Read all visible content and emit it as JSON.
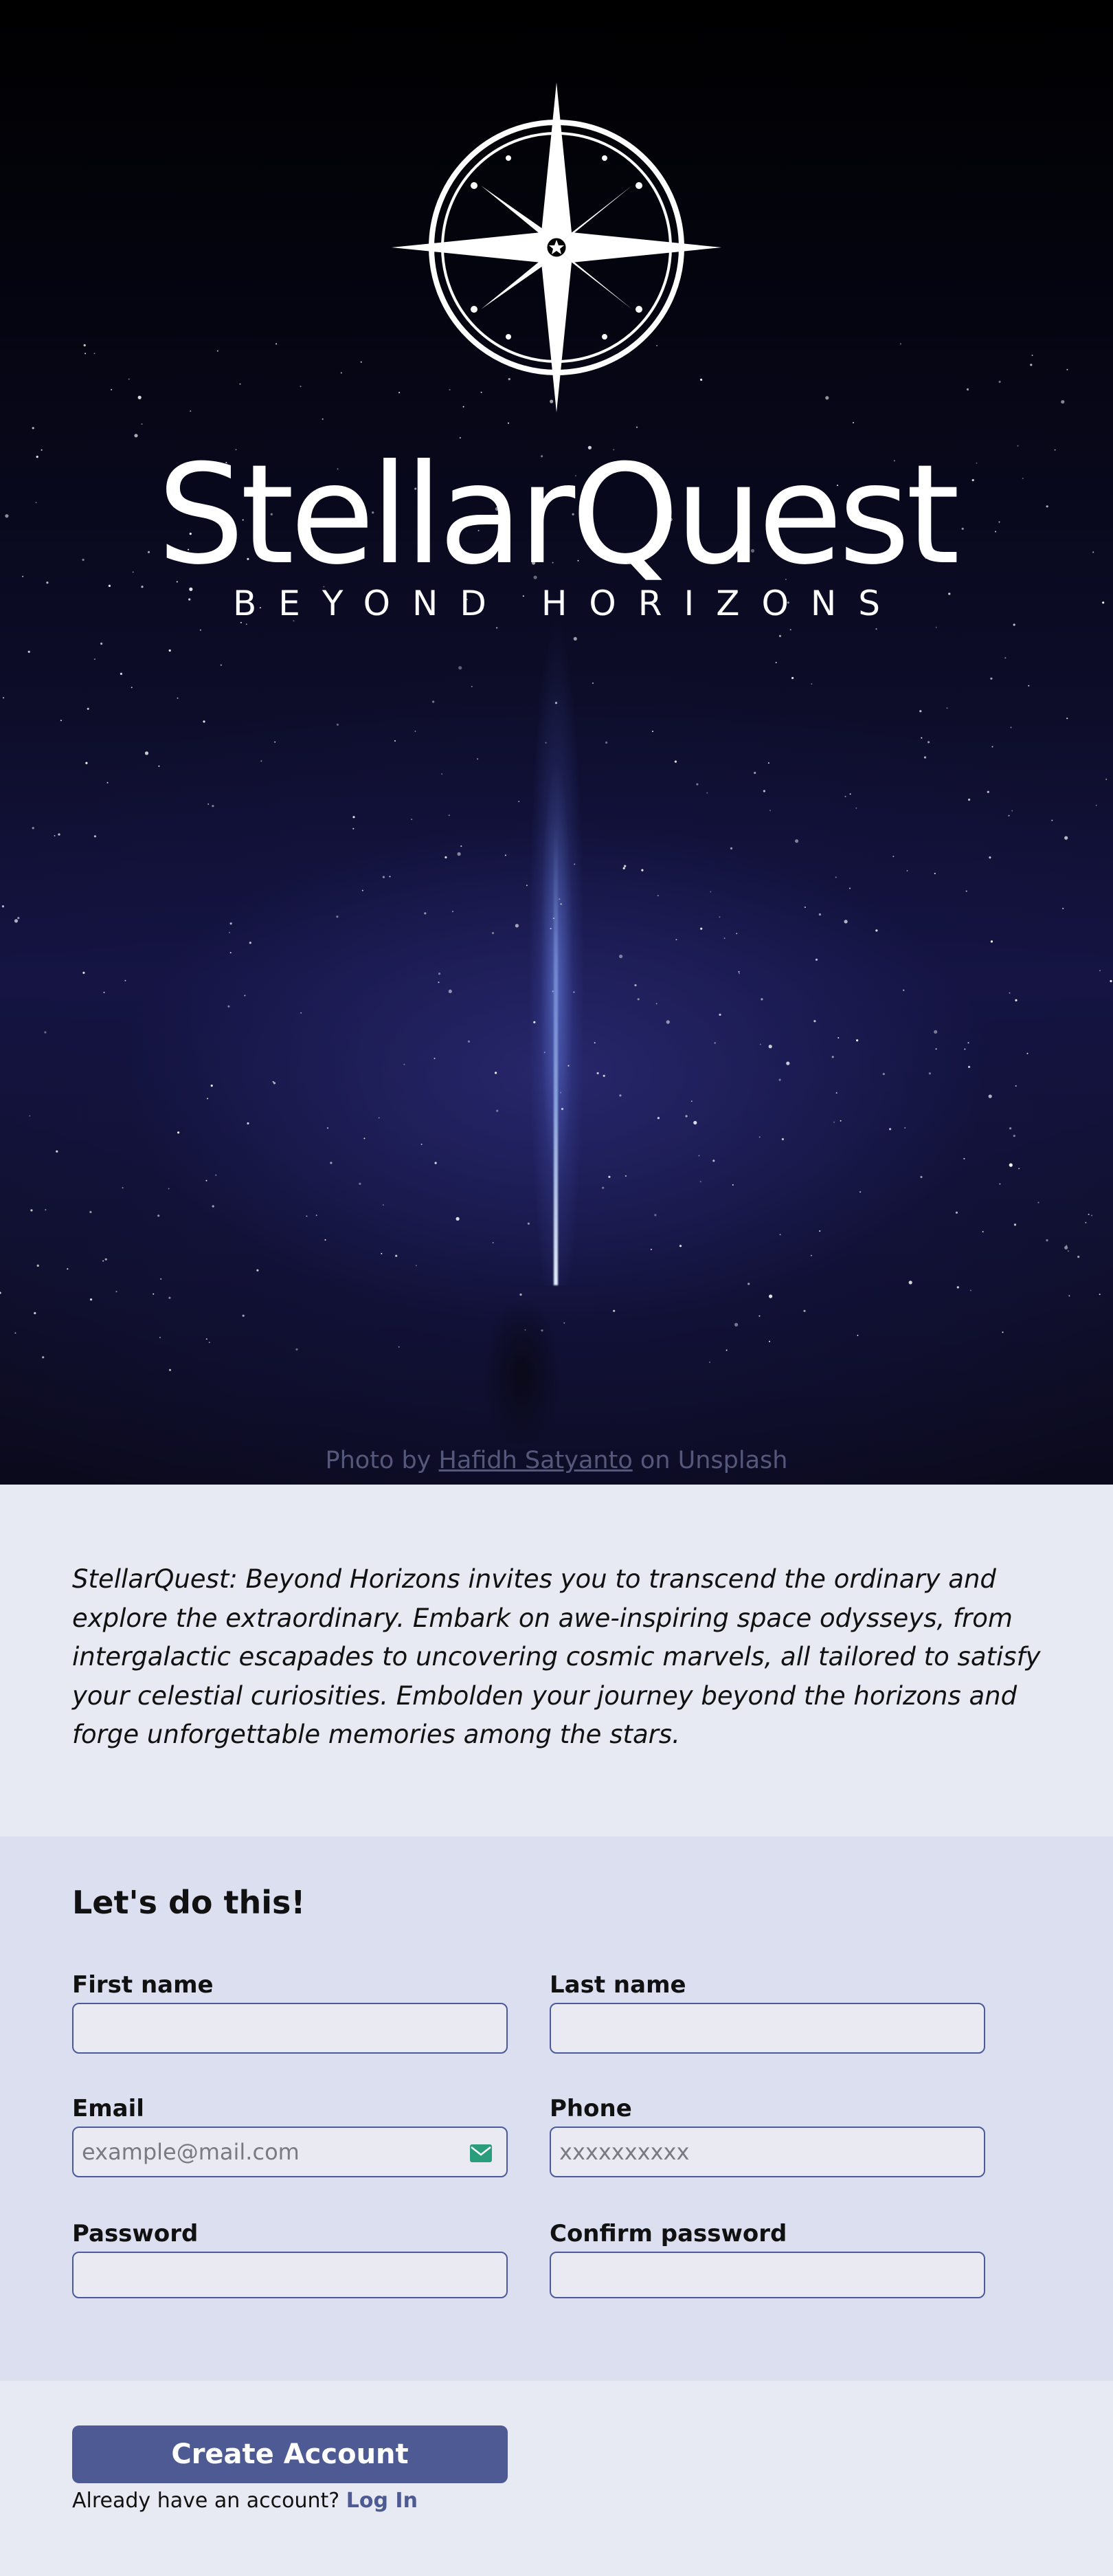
{
  "hero": {
    "brand_name": "StellarQuest",
    "tagline": "BEYOND HORIZONS",
    "credit": {
      "prefix": "Photo by",
      "author": "Hafidh Satyanto",
      "suffix": "on Unsplash"
    },
    "logo_icon": "compass-star-icon"
  },
  "intro": {
    "text": "StellarQuest: Beyond Horizons invites you to transcend the ordinary and explore the extraordinary. Embark on awe-inspiring space odysseys, from intergalactic escapades to uncovering cosmic marvels, all tailored to satisfy your celestial curiosities. Embolden your journey beyond the horizons and forge unforgettable memories among the stars."
  },
  "form": {
    "heading": "Let's do this!",
    "fields": {
      "first_name": {
        "label": "First name",
        "value": "",
        "placeholder": ""
      },
      "last_name": {
        "label": "Last name",
        "value": "",
        "placeholder": ""
      },
      "email": {
        "label": "Email",
        "value": "",
        "placeholder": "example@mail.com",
        "icon": "mail-icon"
      },
      "phone": {
        "label": "Phone",
        "value": "",
        "placeholder": "xxxxxxxxxx"
      },
      "password": {
        "label": "Password",
        "value": "",
        "placeholder": ""
      },
      "confirm_password": {
        "label": "Confirm password",
        "value": "",
        "placeholder": ""
      }
    }
  },
  "actions": {
    "create_account_label": "Create Account",
    "login_prompt": "Already have an account?",
    "login_link": "Log In"
  },
  "colors": {
    "accent": "#4e5a93",
    "input_border": "#4a5a9a",
    "page_background": "#e8eaf3",
    "form_background": "#dcdff0",
    "mail_icon": "#2a9d7c"
  }
}
